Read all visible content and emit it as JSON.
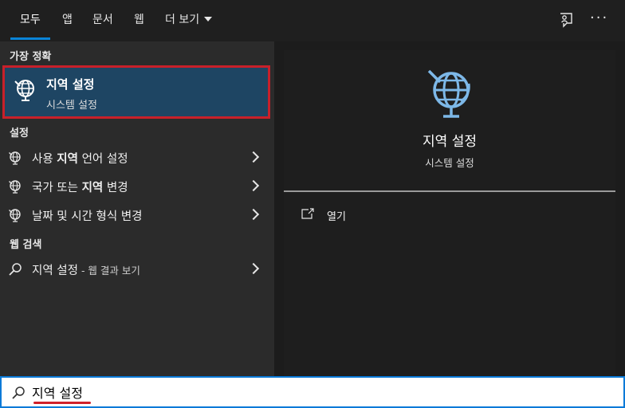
{
  "tabs": [
    {
      "label": "모두"
    },
    {
      "label": "앱"
    },
    {
      "label": "문서"
    },
    {
      "label": "웹"
    },
    {
      "label": "더 보기"
    }
  ],
  "sections": {
    "best_match": "가장 정확",
    "settings": "설정",
    "web_search": "웹 검색"
  },
  "best_match": {
    "title": "지역 설정",
    "subtitle": "시스템 설정"
  },
  "settings_items": [
    {
      "pre": "사용 ",
      "bold": "지역",
      "post": " 언어 설정"
    },
    {
      "pre": "국가 또는 ",
      "bold": "지역",
      "post": " 변경"
    },
    {
      "pre": "날짜 및 시간 형식 변경",
      "bold": "",
      "post": ""
    }
  ],
  "web_item": {
    "query": "지역 설정",
    "suffix": " - 웹 결과 보기"
  },
  "preview": {
    "title": "지역 설정",
    "subtitle": "시스템 설정",
    "open_label": "열기"
  },
  "search": {
    "value": "지역 설정"
  },
  "icons": {
    "feedback": "feedback-icon",
    "more": "ellipsis-icon",
    "globe": "globe-settings-icon",
    "search": "search-icon",
    "open": "open-window-icon"
  },
  "colors": {
    "accent": "#0a84d8",
    "selected_bg": "#1e4563",
    "highlight_border": "#c8202a",
    "globe": "#7db8e8"
  }
}
